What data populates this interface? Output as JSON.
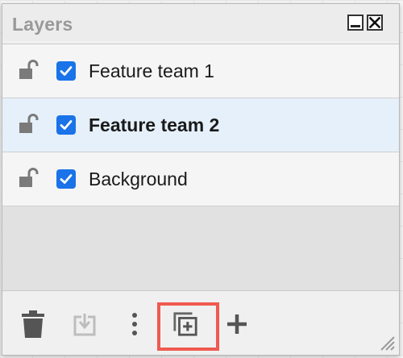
{
  "panel": {
    "title": "Layers"
  },
  "window_controls": {
    "minimize_icon": "minimize-icon",
    "close_icon": "close-icon"
  },
  "layers": [
    {
      "name": "Feature team 1",
      "visible": true,
      "locked": false,
      "selected": false
    },
    {
      "name": "Feature team 2",
      "visible": true,
      "locked": false,
      "selected": true
    },
    {
      "name": "Background",
      "visible": true,
      "locked": false,
      "selected": false
    }
  ],
  "toolbar": {
    "tools": [
      "trash-icon",
      "move-selection-icon",
      "more-vertical-icon",
      "duplicate-icon",
      "plus-icon"
    ],
    "highlighted_tool": "duplicate-icon"
  },
  "colors": {
    "checkbox": "#1a73e8",
    "selected_row": "#e5f0fa",
    "highlight": "#f05a4f",
    "icon": "#555555"
  }
}
